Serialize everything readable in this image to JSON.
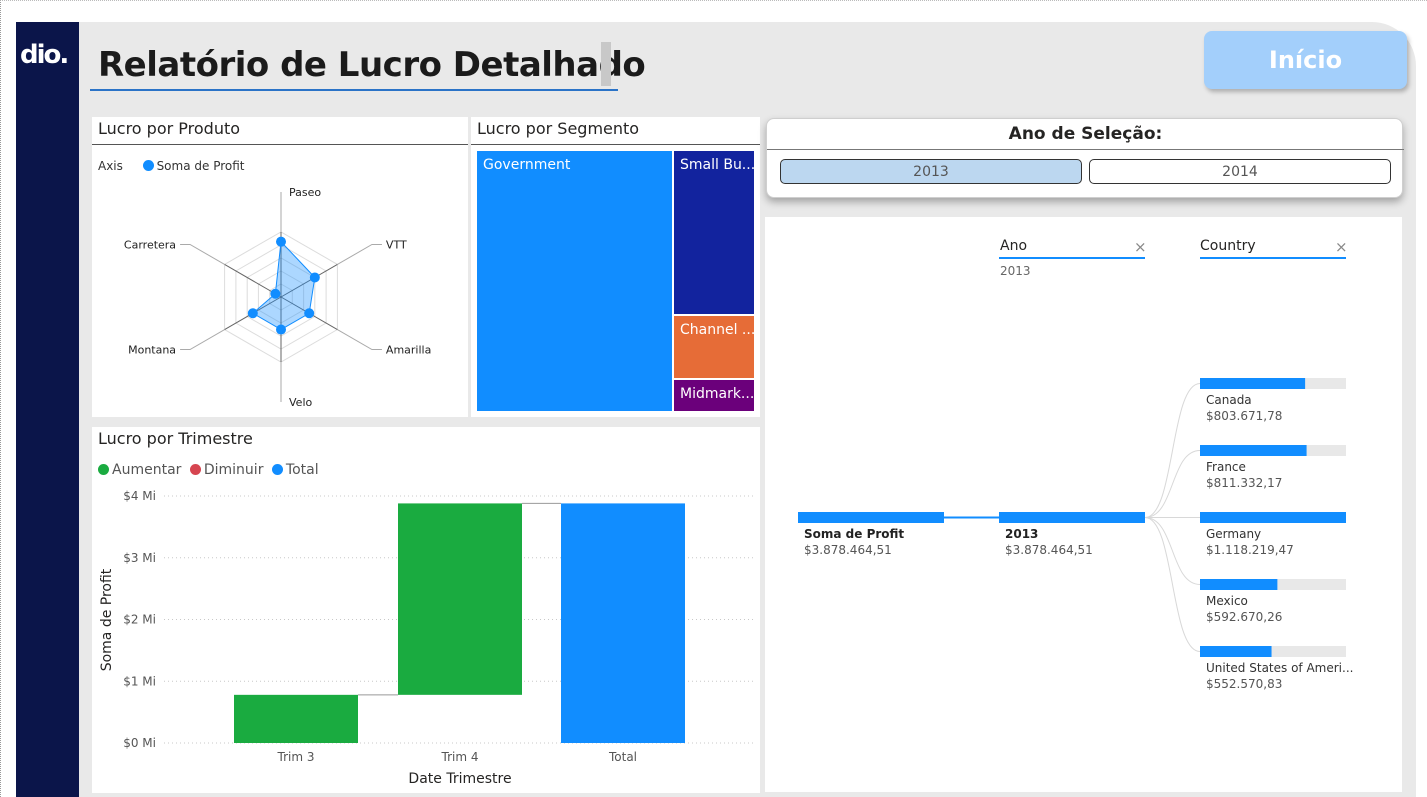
{
  "brand": {
    "logo_text": "dio."
  },
  "header": {
    "title": "Relatório de Lucro Detalhado",
    "home_button": "Início"
  },
  "radar": {
    "title": "Lucro por Produto",
    "legend_axis": "Axis",
    "legend_series": "Soma de Profit",
    "chart_data": {
      "type": "radar",
      "categories": [
        "Paseo",
        "VTT",
        "Amarilla",
        "Velo",
        "Montana",
        "Carretera"
      ],
      "series": [
        {
          "name": "Soma de Profit",
          "values": [
            0.85,
            0.6,
            0.5,
            0.5,
            0.5,
            0.1
          ]
        }
      ]
    }
  },
  "treemap": {
    "title": "Lucro por Segmento",
    "tiles": [
      {
        "label": "Government",
        "color": "#118dff"
      },
      {
        "label": "Small Bu...",
        "color": "#12239e"
      },
      {
        "label": "Channel ...",
        "color": "#e66c37"
      },
      {
        "label": "Midmark...",
        "color": "#6b007b"
      }
    ]
  },
  "waterfall": {
    "title": "Lucro por Trimestre",
    "legend": [
      {
        "label": "Aumentar",
        "color": "#1aab40"
      },
      {
        "label": "Diminuir",
        "color": "#d64550"
      },
      {
        "label": "Total",
        "color": "#118dff"
      }
    ],
    "chart_data": {
      "type": "waterfall",
      "categories": [
        "Trim 3",
        "Trim 4",
        "Total"
      ],
      "steps": [
        {
          "category": "Trim 3",
          "start": 0,
          "end": 0.78,
          "kind": "increase"
        },
        {
          "category": "Trim 4",
          "start": 0.78,
          "end": 3.88,
          "kind": "increase"
        },
        {
          "category": "Total",
          "start": 0,
          "end": 3.88,
          "kind": "total"
        }
      ],
      "y_ticks": [
        "$0 Mi",
        "$1 Mi",
        "$2 Mi",
        "$3 Mi",
        "$4 Mi"
      ],
      "ylim": [
        0,
        4
      ],
      "xlabel": "Date Trimestre",
      "ylabel": "Soma de Profit"
    }
  },
  "slicer": {
    "title": "Ano de Seleção:",
    "options": [
      {
        "label": "2013",
        "selected": true
      },
      {
        "label": "2014",
        "selected": false
      }
    ]
  },
  "decomp_tree": {
    "levels": [
      {
        "header": "Ano",
        "value": "2013"
      },
      {
        "header": "Country",
        "value": ""
      }
    ],
    "root": {
      "label": "Soma de Profit",
      "value": "$3.878.464,51"
    },
    "node": {
      "label": "2013",
      "value": "$3.878.464,51"
    },
    "countries": [
      {
        "label": "Canada",
        "value": "$803.671,78",
        "fraction": 0.72
      },
      {
        "label": "France",
        "value": "$811.332,17",
        "fraction": 0.73
      },
      {
        "label": "Germany",
        "value": "$1.118.219,47",
        "fraction": 1.0
      },
      {
        "label": "Mexico",
        "value": "$592.670,26",
        "fraction": 0.53
      },
      {
        "label": "United States of Ameri...",
        "value": "$552.570,83",
        "fraction": 0.49
      }
    ]
  }
}
